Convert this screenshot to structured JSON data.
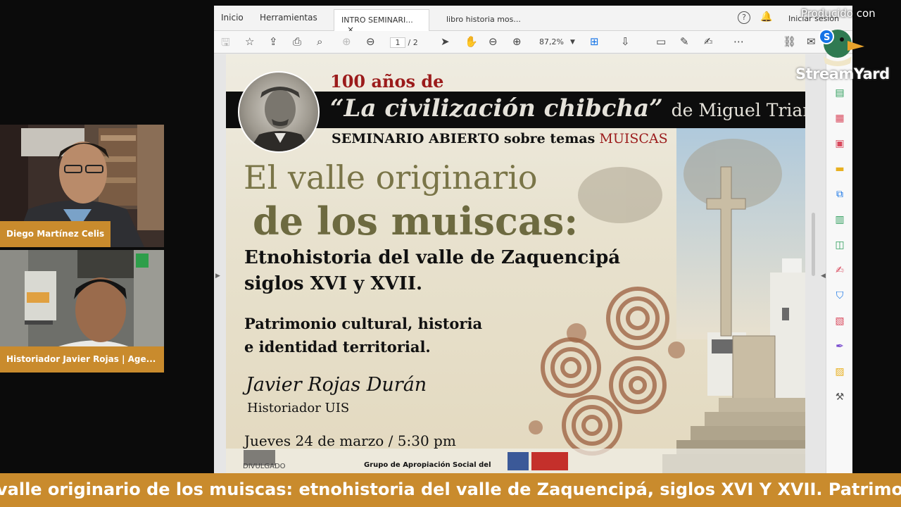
{
  "participants": [
    {
      "name": "Diego Martínez Celis"
    },
    {
      "name": "Historiador Javier Rojas | Age..."
    }
  ],
  "acrobat": {
    "menu": [
      "Inicio",
      "Herramientas"
    ],
    "tabs": [
      {
        "label": "INTRO SEMINARI...",
        "close": "×"
      },
      {
        "label": "libro historia mos..."
      }
    ],
    "signin": "Iniciar sesión",
    "page_current": "1",
    "page_total": "/ 2",
    "zoom": "87,2%"
  },
  "poster": {
    "anniversary": "100 años de",
    "book_title": "“La civilización chibcha”",
    "book_author": "de Miguel Triana",
    "seminar_prefix": "SEMINARIO ABIERTO sobre temas",
    "seminar_topic": "MUISCAS",
    "title_line1": "El valle originario",
    "title_line2": "de los muiscas:",
    "subtitle_line1": "Etnohistoria del valle de Zaquencipá",
    "subtitle_line2": "siglos XVI y XVII.",
    "theme_line1": "Patrimonio cultural, historia",
    "theme_line2": "e identidad territorial.",
    "speaker": "Javier Rojas Durán",
    "speaker_role": "Historiador UIS",
    "date": "Jueves 24 de marzo / 5:30 pm",
    "group": "Grupo de Apropiación Social del",
    "partial": "DIVULGADO"
  },
  "branding": {
    "produced_by": "Producido con",
    "brand": "StreamYard",
    "accent": "#c98b2d"
  },
  "ticker": "valle originario de los muiscas: etnohistoria del valle de Zaquencipá, siglos XVI Y XVII. Patrimonio c"
}
